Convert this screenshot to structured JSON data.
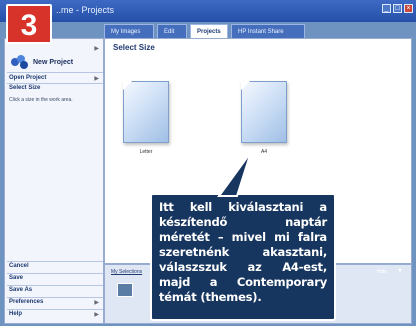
{
  "window": {
    "title": "..me - Projects",
    "controls": [
      "minimize-icon",
      "maximize-icon",
      "close-icon"
    ]
  },
  "step_badge": "3",
  "tabs": [
    {
      "label": "My Images"
    },
    {
      "label": "Edit"
    },
    {
      "label": "Projects",
      "active": true
    },
    {
      "label": "HP Instant Share"
    }
  ],
  "sidebar": {
    "new_project": "New Project",
    "open_project": "Open Project",
    "select_size": "Select Size",
    "hint": "Click a size in the work area.",
    "buttons": {
      "cancel": "Cancel",
      "save": "Save",
      "save_as": "Save As",
      "preferences": "Preferences",
      "help": "Help"
    }
  },
  "main": {
    "title": "Select Size",
    "sizes": [
      {
        "label": "Letter"
      },
      {
        "label": "A4"
      }
    ]
  },
  "bottom_panel": {
    "selection_label": "My Selections",
    "hide_label": "Hide"
  },
  "callout": {
    "text": "Itt kell kiválasztani a készítendő naptár méretét – mivel mi falra szeretnénk akasztani, válaszszuk az A4-est, majd a Contemporary témát (themes)."
  },
  "colors": {
    "accent": "#3e6ac4",
    "badge": "#d8332a",
    "callout_bg": "#17365f"
  }
}
